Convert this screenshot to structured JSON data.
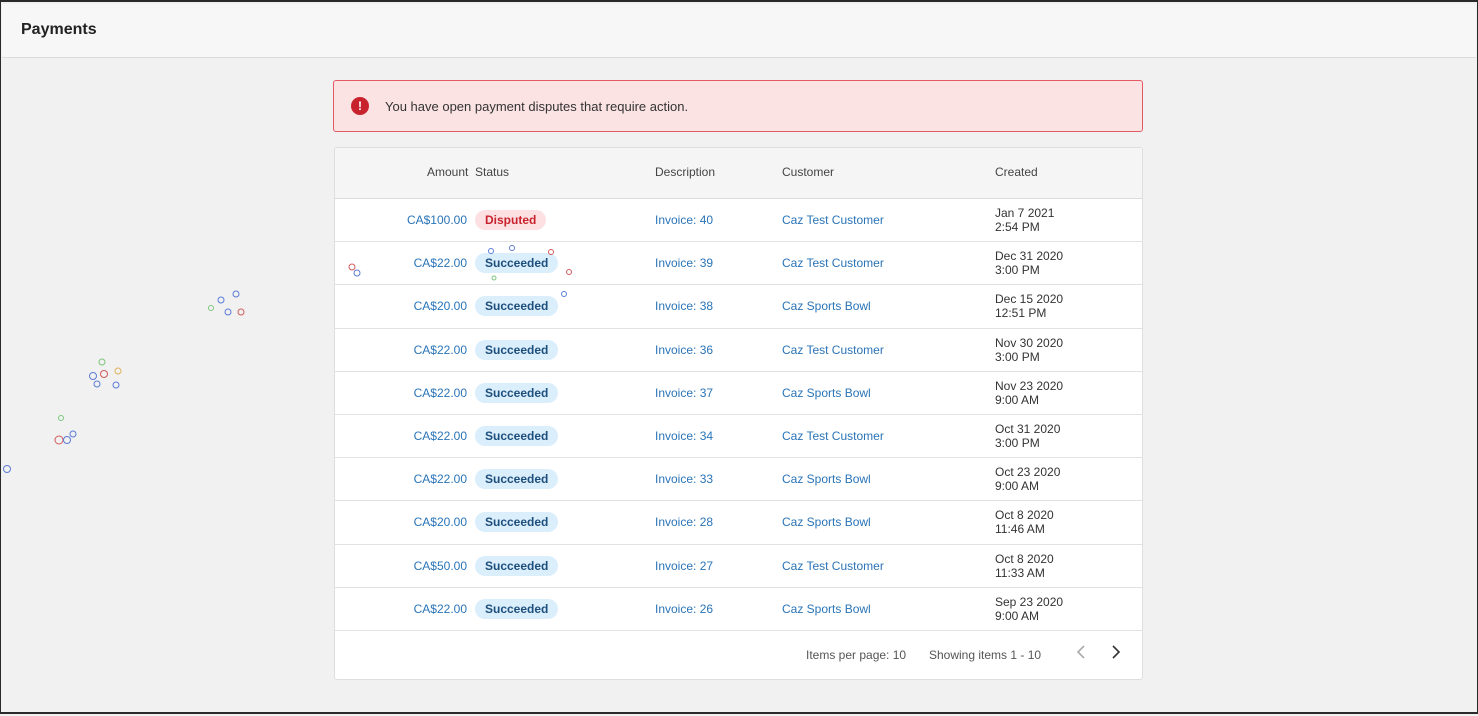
{
  "header": {
    "title": "Payments"
  },
  "alert": {
    "icon": "error-icon",
    "message": "You have open payment disputes that require action."
  },
  "table": {
    "columns": {
      "amount": "Amount",
      "status": "Status",
      "description": "Description",
      "customer": "Customer",
      "created": "Created"
    },
    "rows": [
      {
        "amount": "CA$100.00",
        "status": "Disputed",
        "status_kind": "disputed",
        "description": "Invoice: 40",
        "customer": "Caz Test Customer",
        "created_date": "Jan 7 2021",
        "created_time": "2:54 PM"
      },
      {
        "amount": "CA$22.00",
        "status": "Succeeded",
        "status_kind": "succeeded",
        "description": "Invoice: 39",
        "customer": "Caz Test Customer",
        "created_date": "Dec 31 2020",
        "created_time": "3:00 PM"
      },
      {
        "amount": "CA$20.00",
        "status": "Succeeded",
        "status_kind": "succeeded",
        "description": "Invoice: 38",
        "customer": "Caz Sports Bowl",
        "created_date": "Dec 15 2020",
        "created_time": "12:51 PM"
      },
      {
        "amount": "CA$22.00",
        "status": "Succeeded",
        "status_kind": "succeeded",
        "description": "Invoice: 36",
        "customer": "Caz Test Customer",
        "created_date": "Nov 30 2020",
        "created_time": "3:00 PM"
      },
      {
        "amount": "CA$22.00",
        "status": "Succeeded",
        "status_kind": "succeeded",
        "description": "Invoice: 37",
        "customer": "Caz Sports Bowl",
        "created_date": "Nov 23 2020",
        "created_time": "9:00 AM"
      },
      {
        "amount": "CA$22.00",
        "status": "Succeeded",
        "status_kind": "succeeded",
        "description": "Invoice: 34",
        "customer": "Caz Test Customer",
        "created_date": "Oct 31 2020",
        "created_time": "3:00 PM"
      },
      {
        "amount": "CA$22.00",
        "status": "Succeeded",
        "status_kind": "succeeded",
        "description": "Invoice: 33",
        "customer": "Caz Sports Bowl",
        "created_date": "Oct 23 2020",
        "created_time": "9:00 AM"
      },
      {
        "amount": "CA$20.00",
        "status": "Succeeded",
        "status_kind": "succeeded",
        "description": "Invoice: 28",
        "customer": "Caz Sports Bowl",
        "created_date": "Oct 8 2020",
        "created_time": "11:46 AM"
      },
      {
        "amount": "CA$50.00",
        "status": "Succeeded",
        "status_kind": "succeeded",
        "description": "Invoice: 27",
        "customer": "Caz Test Customer",
        "created_date": "Oct 8 2020",
        "created_time": "11:33 AM"
      },
      {
        "amount": "CA$22.00",
        "status": "Succeeded",
        "status_kind": "succeeded",
        "description": "Invoice: 26",
        "customer": "Caz Sports Bowl",
        "created_date": "Sep 23 2020",
        "created_time": "9:00 AM"
      }
    ]
  },
  "pagination": {
    "items_per_page": "Items per page: 10",
    "showing": "Showing items 1 - 10",
    "prev_icon": "chevron-left-icon",
    "next_icon": "chevron-right-icon"
  },
  "colors": {
    "link": "#2a74b7",
    "alert_bg": "#fbe3e4",
    "alert_border": "#e35a63",
    "error": "#c8232c",
    "success_badge": "#dbeefc"
  }
}
